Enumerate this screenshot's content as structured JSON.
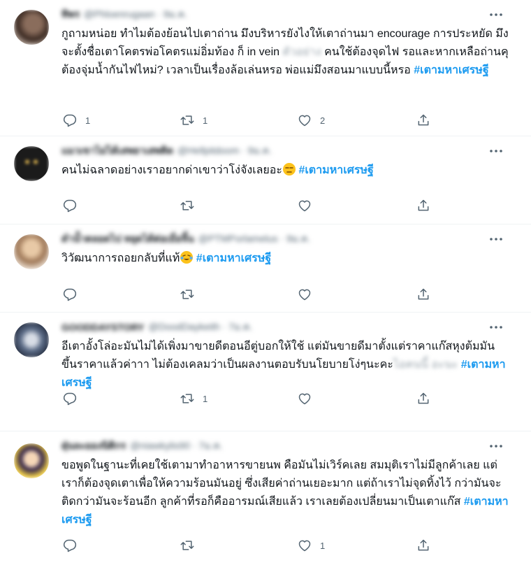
{
  "colors": {
    "accent": "#1d9bf0",
    "secondary_text": "#536471",
    "divider": "#eff3f4"
  },
  "icons": [
    "reply-icon",
    "retweet-icon",
    "like-icon",
    "share-icon",
    "more-icon"
  ],
  "tweets": [
    {
      "author": {
        "name": "ทิพร",
        "handle": "@Phloenrugaan · 9ม.ค."
      },
      "text": "กูถามหน่อย ทำไมต้องย้อนไปเตาถ่าน มึงบริหารยังไงให้เตาถ่านมา encourage การประหยัด มึงจะตั้งชื่อเตาโคตรพ่อโคตรแม่อิ่มท้อง ก็ in vein",
      "censored": "ตัวอย่าง",
      "text_after": " คนใช้ต้องจุดไฟ รอและหากเหลือถ่านคุ ต้องจุ่มน้ำกันไฟไหม่? เวลาเป็นเรื่องล้อเล่นหรอ พ่อแม่มึงสอนมาแบบนี้หรอ",
      "hashtag": "#เตามหาเศรษฐี",
      "stats": {
        "replies": "1",
        "retweets": "1",
        "likes": "2"
      }
    },
    {
      "author": {
        "name": "แมวเขาไม่ได้เสพยาเสพติด",
        "handle": "@Hellpitdoom · 9ม.ค."
      },
      "text": "คนไม่ฉลาดอย่างเราอยากด่าเขาว่าโง่จังเลยอะ",
      "hashtag": "#เตามหาเศรษฐี",
      "stats": {
        "replies": "",
        "retweets": "",
        "likes": ""
      }
    },
    {
      "author": {
        "name": "ดำน้ำตลอดไป หยุดได้ต่อเมื่อจิ้น",
        "handle": "@PTMPorlamelus · 9ม.ค."
      },
      "text": "วิวัฒนาการถอยกลับที่แท้",
      "hashtag": "#เตามหาเศรษฐี",
      "stats": {
        "replies": "",
        "retweets": "",
        "likes": ""
      }
    },
    {
      "author": {
        "name": "GOODDAYSTORY",
        "handle": "@DoodDaykeith · 7ม.ค."
      },
      "text": "อีเตาอั้งโล่อะมันไม่ได้เพิ่งมาขายดีตอนอีตู่บอกให้ใช้ แต่มันขายดีมาตั้งแต่ราคาแก๊สหุงต้มมันขึ้นราคาแล้วค่าาา ไม่ต้องเคลมว่าเป็นผลงานตอบรับนโยบายโง่ๆนะคะ",
      "censored": "ไอคนนี้ อะนะ",
      "text_after": " ",
      "hashtag": "#เตามหาเศรษฐี",
      "stats": {
        "replies": "",
        "retweets": "1",
        "likes": ""
      }
    },
    {
      "author": {
        "name": "ฝุ่นละอองนิติกร",
        "handle": "@niawkylis90 · 7ม.ค."
      },
      "text": "ขอพูดในฐานะที่เคยใช้เตามาทำอาหารขายนพ คือมันไม่เวิร์คเลย สมมุติเราไม่มีลูกค้าเลย แต่เราก็ต้องจุดเตาเพื่อให้ความร้อนมันอยู่ ซึ่งเสียค่าถ่านเยอะมาก แต่ถ้าเราไม่จุดทิ้งไว้ กว่ามันจะติดกว่ามันจะร้อนอีก ลูกค้าที่รอก็คืออารมณ์เสียแล้ว เราเลยต้องเปลี่ยนมาเป็นเตาแก๊ส",
      "hashtag": "#เตามหาเศรษฐี",
      "stats": {
        "replies": "",
        "retweets": "",
        "likes": "1"
      }
    }
  ]
}
